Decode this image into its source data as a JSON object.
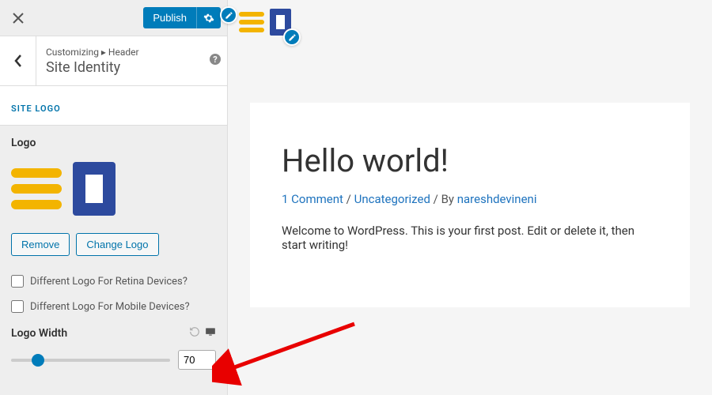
{
  "topbar": {
    "publish": "Publish"
  },
  "breadcrumb": {
    "path": "Customizing ▸ Header",
    "title": "Site Identity"
  },
  "section": {
    "title": "SITE LOGO"
  },
  "logo": {
    "label": "Logo",
    "remove": "Remove",
    "change": "Change Logo",
    "retina": "Different Logo For Retina Devices?",
    "mobile": "Different Logo For Mobile Devices?"
  },
  "width": {
    "label": "Logo Width",
    "value": "70"
  },
  "post": {
    "title": "Hello world!",
    "comment": "1 Comment",
    "category": "Uncategorized",
    "author": "nareshdevineni",
    "body": "Welcome to WordPress. This is your first post. Edit or delete it, then start writing!"
  },
  "colors": {
    "accent": "#007cba",
    "link": "#1e73be"
  }
}
